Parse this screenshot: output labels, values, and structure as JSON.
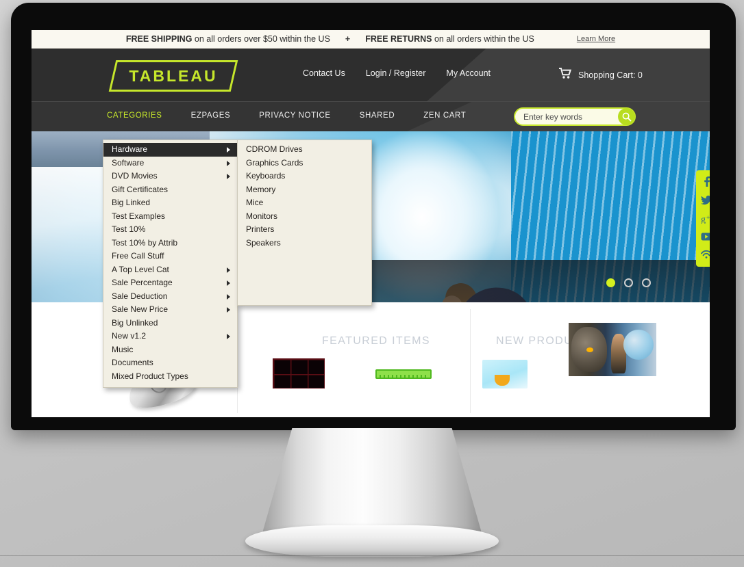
{
  "promo": {
    "shipping_bold": "FREE SHIPPING",
    "shipping_rest": " on all orders over $50 within the US",
    "separator": "+",
    "returns_bold": "FREE RETURNS",
    "returns_rest": " on all orders within the US",
    "learn_more": "Learn More"
  },
  "header": {
    "logo_text": "TABLEAU",
    "links": [
      {
        "label": "Contact Us"
      },
      {
        "label": "Login / Register"
      },
      {
        "label": "My Account"
      }
    ],
    "cart_label": "Shopping Cart: 0",
    "cart_icon": "shopping-cart-icon"
  },
  "mainnav": {
    "items": [
      {
        "label": "CATEGORIES",
        "active": true
      },
      {
        "label": "EZPAGES",
        "active": false
      },
      {
        "label": "PRIVACY NOTICE",
        "active": false
      },
      {
        "label": "SHARED",
        "active": false
      },
      {
        "label": "ZEN CART",
        "active": false
      }
    ],
    "search_placeholder": "Enter key words",
    "search_value": "",
    "search_icon": "search-icon"
  },
  "hero": {
    "carousel_dots": [
      {
        "active": true
      },
      {
        "active": false
      },
      {
        "active": false
      }
    ],
    "social_icons": [
      {
        "name": "facebook-icon",
        "glyph": "f"
      },
      {
        "name": "twitter-icon",
        "glyph": "t"
      },
      {
        "name": "google-plus-icon",
        "glyph": "g+"
      },
      {
        "name": "youtube-icon",
        "glyph": "yt"
      },
      {
        "name": "rss-icon",
        "glyph": "rss"
      }
    ]
  },
  "content": {
    "featured_title": "FEATURED ITEMS",
    "new_products_title": "NEW PRODUCTS"
  },
  "dropdown": {
    "items": [
      {
        "label": "Hardware",
        "submenu": true,
        "selected": true
      },
      {
        "label": "Software",
        "submenu": true,
        "selected": false
      },
      {
        "label": "DVD Movies",
        "submenu": true,
        "selected": false
      },
      {
        "label": "Gift Certificates",
        "submenu": false,
        "selected": false
      },
      {
        "label": "Big Linked",
        "submenu": false,
        "selected": false
      },
      {
        "label": "Test Examples",
        "submenu": false,
        "selected": false
      },
      {
        "label": "Test 10%",
        "submenu": false,
        "selected": false
      },
      {
        "label": "Test 10% by Attrib",
        "submenu": false,
        "selected": false
      },
      {
        "label": "Free Call Stuff",
        "submenu": false,
        "selected": false
      },
      {
        "label": "A Top Level Cat",
        "submenu": true,
        "selected": false
      },
      {
        "label": "Sale Percentage",
        "submenu": true,
        "selected": false
      },
      {
        "label": "Sale Deduction",
        "submenu": true,
        "selected": false
      },
      {
        "label": "Sale New Price",
        "submenu": true,
        "selected": false
      },
      {
        "label": "Big Unlinked",
        "submenu": false,
        "selected": false
      },
      {
        "label": "New v1.2",
        "submenu": true,
        "selected": false
      },
      {
        "label": "Music",
        "submenu": false,
        "selected": false
      },
      {
        "label": "Documents",
        "submenu": false,
        "selected": false
      },
      {
        "label": "Mixed Product Types",
        "submenu": false,
        "selected": false
      }
    ]
  },
  "submenu": {
    "items": [
      {
        "label": "CDROM Drives"
      },
      {
        "label": "Graphics Cards"
      },
      {
        "label": "Keyboards"
      },
      {
        "label": "Memory"
      },
      {
        "label": "Mice"
      },
      {
        "label": "Monitors"
      },
      {
        "label": "Printers"
      },
      {
        "label": "Speakers"
      }
    ]
  },
  "colors": {
    "accent_lime": "#c6e72b",
    "header_dark": "#2e2e2e",
    "header_light": "#3f3f3f",
    "menu_bg": "#f2efe4",
    "menu_selected": "#2b2b2b",
    "promo_bg": "#faf8f0"
  }
}
